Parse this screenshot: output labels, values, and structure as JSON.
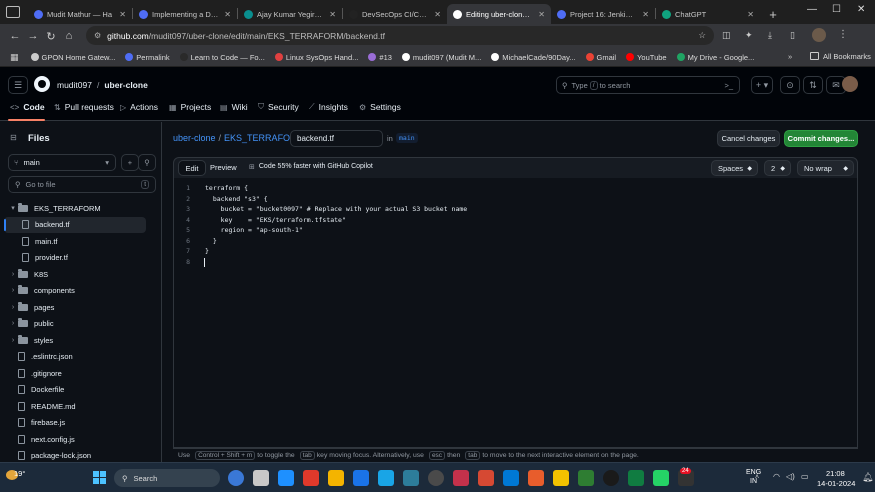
{
  "browser": {
    "tabs": [
      {
        "label": "Mudit Mathur — Ha",
        "color": "#4f6df5",
        "active": false
      },
      {
        "label": "Implementing a Dev",
        "color": "#4f6df5",
        "active": false
      },
      {
        "label": "Ajay Kumar Yegireddi",
        "color": "#0a8f8f",
        "active": false
      },
      {
        "label": "DevSecOps CI/CD Pi",
        "color": "#222222",
        "active": false
      },
      {
        "label": "Editing uber-clone/E",
        "color": "#ffffff",
        "active": true
      },
      {
        "label": "Project 16: Jenkins D",
        "color": "#4f6df5",
        "active": false
      },
      {
        "label": "ChatGPT",
        "color": "#10a37f",
        "active": false
      }
    ],
    "url_host": "github.com",
    "url_path": "/mudit097/uber-clone/edit/main/EKS_TERRAFORM/backend.tf",
    "bookmarks": [
      {
        "label": "GPON Home Gatew...",
        "color": "#cccccc"
      },
      {
        "label": "Permalink",
        "color": "#4f6df5"
      },
      {
        "label": "Learn to Code — Fo...",
        "color": "#2a2a2a"
      },
      {
        "label": "Linux SysOps Hand...",
        "color": "#e04040"
      },
      {
        "label": "#13",
        "color": "#9a6dd7"
      },
      {
        "label": "mudit097 (Mudit M...",
        "color": "#ffffff"
      },
      {
        "label": "MichaelCade/90Day...",
        "color": "#ffffff"
      },
      {
        "label": "Gmail",
        "color": "#ea4335"
      },
      {
        "label": "YouTube",
        "color": "#ff0000"
      },
      {
        "label": "My Drive - Google...",
        "color": "#1fa463"
      }
    ],
    "all_bookmarks": "All Bookmarks"
  },
  "github": {
    "owner": "mudit097",
    "repo": "uber-clone",
    "search_placeholder_pre": "Type",
    "search_placeholder_key": "/",
    "search_placeholder_post": "to search",
    "repo_nav": [
      "Code",
      "Pull requests",
      "Actions",
      "Projects",
      "Wiki",
      "Security",
      "Insights",
      "Settings"
    ]
  },
  "sidebar": {
    "title": "Files",
    "branch": "main",
    "goto_placeholder": "Go to file",
    "goto_key": "t",
    "tree": [
      {
        "label": "EKS_TERRAFORM",
        "type": "folder",
        "depth": 0,
        "expanded": true
      },
      {
        "label": "backend.tf",
        "type": "file",
        "depth": 1,
        "active": true
      },
      {
        "label": "main.tf",
        "type": "file",
        "depth": 1
      },
      {
        "label": "provider.tf",
        "type": "file",
        "depth": 1
      },
      {
        "label": "K8S",
        "type": "folder",
        "depth": 0
      },
      {
        "label": "components",
        "type": "folder",
        "depth": 0
      },
      {
        "label": "pages",
        "type": "folder",
        "depth": 0
      },
      {
        "label": "public",
        "type": "folder",
        "depth": 0
      },
      {
        "label": "styles",
        "type": "folder",
        "depth": 0
      },
      {
        "label": ".eslintrc.json",
        "type": "file",
        "depth": 0
      },
      {
        "label": ".gitignore",
        "type": "file",
        "depth": 0
      },
      {
        "label": "Dockerfile",
        "type": "file",
        "depth": 0
      },
      {
        "label": "README.md",
        "type": "file",
        "depth": 0
      },
      {
        "label": "firebase.js",
        "type": "file",
        "depth": 0
      },
      {
        "label": "next.config.js",
        "type": "file",
        "depth": 0
      },
      {
        "label": "package-lock.json",
        "type": "file",
        "depth": 0
      }
    ]
  },
  "editor": {
    "crumb_repo": "uber-clone",
    "crumb_folder": "EKS_TERRAFORM",
    "filename": "backend.tf",
    "in_label": "in",
    "branch": "main",
    "cancel_label": "Cancel changes",
    "commit_label": "Commit changes...",
    "tab_edit": "Edit",
    "tab_preview": "Preview",
    "copilot_text": "Code 55% faster with GitHub Copilot",
    "indent_mode": "Spaces",
    "indent_size": "2",
    "wrap_mode": "No wrap",
    "lines": [
      "terraform {",
      "  backend \"s3\" {",
      "    bucket = \"bucket0097\" # Replace with your actual S3 bucket name",
      "    key    = \"EKS/terraform.tfstate\"",
      "    region = \"ap-south-1\"",
      "  }",
      "}",
      ""
    ],
    "status_parts": [
      "Use",
      "Control + Shift + m",
      "to toggle the",
      "tab",
      "key moving focus. Alternatively, use",
      "esc",
      "then",
      "tab",
      "to move to the next interactive element on the page."
    ]
  },
  "taskbar": {
    "temp": "19°",
    "search_label": "Search",
    "lang_top": "ENG",
    "lang_bottom": "IN",
    "time": "21:08",
    "date": "14-01-2024",
    "badge": "24"
  }
}
